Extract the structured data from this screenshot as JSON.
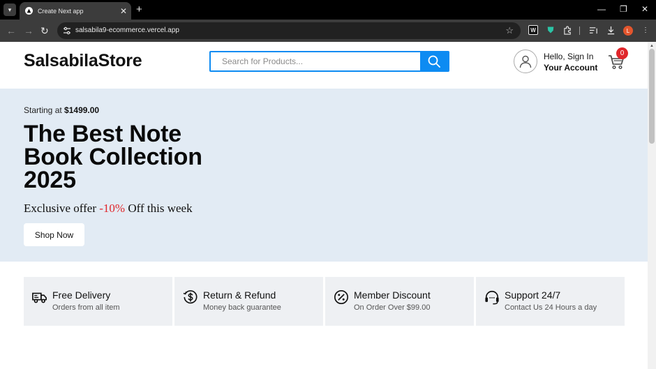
{
  "browser": {
    "tab_title": "Create Next app",
    "url": "salsabila9-ecommerce.vercel.app",
    "profile_initial": "L"
  },
  "header": {
    "logo": "SalsabilaStore",
    "search_placeholder": "Search for Products...",
    "account_greeting": "Hello, Sign In",
    "account_label": "Your Account",
    "cart_count": "0"
  },
  "hero": {
    "starting_prefix": "Starting at",
    "starting_price": "$1499.00",
    "title": "The Best Note Book Collection 2025",
    "offer_prefix": "Exclusive offer",
    "offer_discount": "-10%",
    "offer_suffix": "Off this week",
    "cta": "Shop Now",
    "background": "#e2ebf4"
  },
  "features": [
    {
      "icon": "delivery-truck-icon",
      "title": "Free Delivery",
      "subtitle": "Orders from all item"
    },
    {
      "icon": "refund-icon",
      "title": "Return & Refund",
      "subtitle": "Money back guarantee"
    },
    {
      "icon": "discount-icon",
      "title": "Member Discount",
      "subtitle": "On Order Over $99.00"
    },
    {
      "icon": "support-headset-icon",
      "title": "Support 24/7",
      "subtitle": "Contact Us 24 Hours a day"
    }
  ],
  "colors": {
    "accent": "#0d8bf2",
    "badge": "#e0262b",
    "feature_bg": "#eef0f3"
  }
}
